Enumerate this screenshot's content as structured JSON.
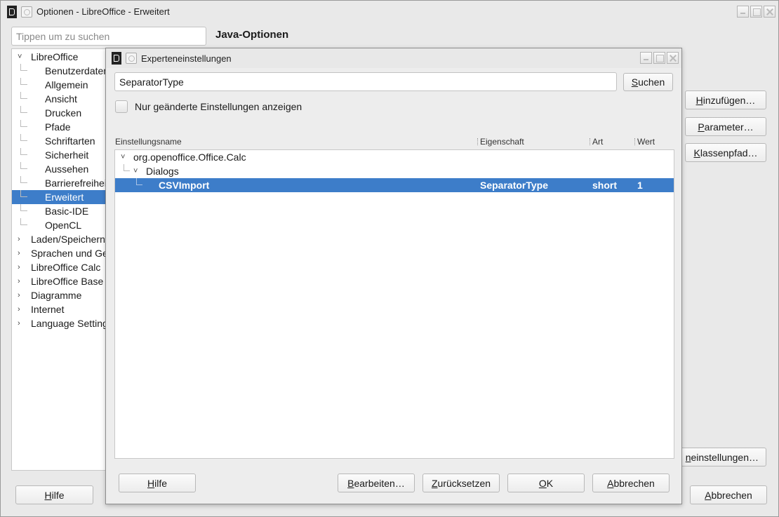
{
  "outer": {
    "title": "Optionen - LibreOffice - Erweitert",
    "search_placeholder": "Tippen um zu suchen",
    "section_title": "Java-Optionen",
    "tree": [
      {
        "label": "LibreOffice",
        "level": 0,
        "expanded": true
      },
      {
        "label": "Benutzerdaten",
        "level": 1
      },
      {
        "label": "Allgemein",
        "level": 1
      },
      {
        "label": "Ansicht",
        "level": 1
      },
      {
        "label": "Drucken",
        "level": 1
      },
      {
        "label": "Pfade",
        "level": 1
      },
      {
        "label": "Schriftarten",
        "level": 1
      },
      {
        "label": "Sicherheit",
        "level": 1
      },
      {
        "label": "Aussehen",
        "level": 1
      },
      {
        "label": "Barrierefreiheit",
        "level": 1
      },
      {
        "label": "Erweitert",
        "level": 1,
        "selected": true
      },
      {
        "label": "Basic-IDE",
        "level": 1
      },
      {
        "label": "OpenCL",
        "level": 1
      },
      {
        "label": "Laden/Speichern",
        "level": 0,
        "expanded": false
      },
      {
        "label": "Sprachen und Gebietsschemata",
        "level": 0,
        "expanded": false
      },
      {
        "label": "LibreOffice Calc",
        "level": 0,
        "expanded": false
      },
      {
        "label": "LibreOffice Base",
        "level": 0,
        "expanded": false
      },
      {
        "label": "Diagramme",
        "level": 0,
        "expanded": false
      },
      {
        "label": "Internet",
        "level": 0,
        "expanded": false
      },
      {
        "label": "Language Settings",
        "level": 0,
        "expanded": false
      }
    ],
    "buttons": {
      "add": "Hinzufügen…",
      "parameters": "Parameter…",
      "classpath": "Klassenpfad…",
      "expert": "neinstellungen…",
      "help": "Hilfe",
      "cancel": "Abbrechen"
    }
  },
  "dialog": {
    "title": "Experteneinstellungen",
    "search_value": "SeparatorType",
    "search_button": "Suchen",
    "only_modified_label": "Nur geänderte Einstellungen anzeigen",
    "only_modified_checked": false,
    "columns": [
      "Einstellungsname",
      "Eigenschaft",
      "Art",
      "Wert"
    ],
    "rows": [
      {
        "name": "org.openoffice.Office.Calc",
        "property": "",
        "type": "",
        "value": "",
        "level": 0,
        "expanded": true
      },
      {
        "name": "Dialogs",
        "property": "",
        "type": "",
        "value": "",
        "level": 1,
        "expanded": true
      },
      {
        "name": "CSVImport",
        "property": "SeparatorType",
        "type": "short",
        "value": "1",
        "level": 2,
        "selected": true
      }
    ],
    "buttons": {
      "help": "Hilfe",
      "edit": "Bearbeiten…",
      "reset": "Zurücksetzen",
      "ok": "OK",
      "cancel": "Abbrechen"
    }
  },
  "colors": {
    "selection": "#3d7dc9",
    "window_bg": "#e9e9e9"
  }
}
